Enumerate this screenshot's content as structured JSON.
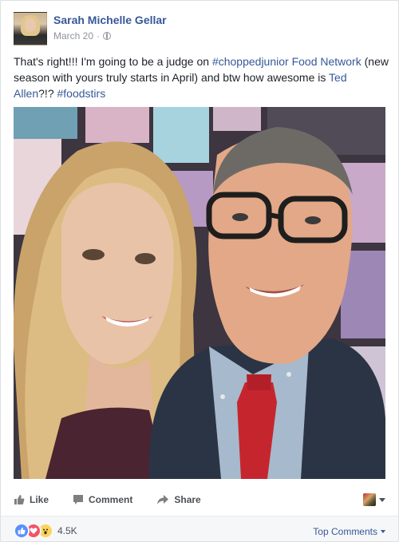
{
  "post": {
    "author": "Sarah Michelle Gellar",
    "date": "March 20",
    "separator": "·",
    "text": {
      "part1": "That's right!!! I'm going to be a judge on ",
      "hashtag1": "#choppedjunior",
      "space1": " ",
      "link1": "Food Network",
      "part2": " (new season with yours truly starts in April) and btw how awesome is ",
      "link2": "Ted Allen",
      "part3": "?!? ",
      "hashtag2": "#foodstirs"
    }
  },
  "actions": {
    "like_label": "Like",
    "comment_label": "Comment",
    "share_label": "Share"
  },
  "footer": {
    "reaction_count": "4.5K",
    "top_comments_label": "Top Comments"
  },
  "colors": {
    "link": "#365899",
    "like_reaction": "#5890ff",
    "love_reaction": "#f25268",
    "wow_reaction": "#fcd45b"
  },
  "icons": {
    "audience": "globe-icon",
    "like": "thumbs-up-icon",
    "comment": "comment-bubble-icon",
    "share": "share-arrow-icon"
  }
}
